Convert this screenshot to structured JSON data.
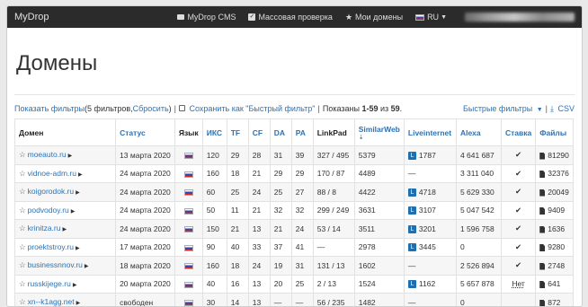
{
  "navbar": {
    "brand": "MyDrop",
    "cms": "MyDrop CMS",
    "bulk": "Массовая проверка",
    "my_domains": "Мои домены",
    "lang": "RU"
  },
  "page_title": "Домены",
  "toolbar": {
    "show_filters": "Показать фильтры",
    "filters_count": " (5 фильтров, ",
    "reset": "Сбросить",
    "close_paren": ")",
    "save_filter": "Сохранить как \"Быстрый фильтр\"",
    "shown_prefix": "Показаны ",
    "shown_range": "1-59",
    "shown_of": " из ",
    "shown_total": "59",
    "shown_dot": ".",
    "quick_filters": "Быстрые фильтры",
    "csv": "CSV"
  },
  "columns": [
    "Домен",
    "Статус",
    "Язык",
    "ИКС",
    "TF",
    "CF",
    "DA",
    "PA",
    "LinkPad",
    "SimilarWeb",
    "Liveinternet",
    "Alexa",
    "Ставка",
    "Файлы"
  ],
  "rows": [
    {
      "domain": "moeauto.ru",
      "status": "13 марта 2020",
      "iks": "120",
      "tf": "29",
      "cf": "28",
      "da": "31",
      "pa": "39",
      "linkpad": "327 / 495",
      "sw": "5379",
      "li": "1787",
      "alexa": "4 641 687",
      "bid": "✔",
      "files": "81290"
    },
    {
      "domain": "vidnoe-adm.ru",
      "status": "24 марта 2020",
      "iks": "160",
      "tf": "18",
      "cf": "21",
      "da": "29",
      "pa": "29",
      "linkpad": "170 / 87",
      "sw": "4489",
      "li": "—",
      "alexa": "3 311 040",
      "bid": "✔",
      "files": "32376"
    },
    {
      "domain": "koigorodok.ru",
      "status": "24 марта 2020",
      "iks": "60",
      "tf": "25",
      "cf": "24",
      "da": "25",
      "pa": "27",
      "linkpad": "88 / 8",
      "sw": "4422",
      "li": "4718",
      "alexa": "5 629 330",
      "bid": "✔",
      "files": "20049"
    },
    {
      "domain": "podvodoy.ru",
      "status": "24 марта 2020",
      "iks": "50",
      "tf": "11",
      "cf": "21",
      "da": "32",
      "pa": "32",
      "linkpad": "299 / 249",
      "sw": "3631",
      "li": "3107",
      "alexa": "5 047 542",
      "bid": "✔",
      "files": "9409"
    },
    {
      "domain": "krinitza.ru",
      "status": "24 марта 2020",
      "iks": "150",
      "tf": "21",
      "cf": "13",
      "da": "21",
      "pa": "24",
      "linkpad": "53 / 14",
      "sw": "3511",
      "li": "3201",
      "alexa": "1 596 758",
      "bid": "✔",
      "files": "1636"
    },
    {
      "domain": "proektstroy.ru",
      "status": "17 марта 2020",
      "iks": "90",
      "tf": "40",
      "cf": "33",
      "da": "37",
      "pa": "41",
      "linkpad": "—",
      "sw": "2978",
      "li": "3445",
      "alexa": "0",
      "bid": "✔",
      "files": "9280"
    },
    {
      "domain": "businessnnov.ru",
      "status": "18 марта 2020",
      "iks": "160",
      "tf": "18",
      "cf": "24",
      "da": "19",
      "pa": "31",
      "linkpad": "131 / 13",
      "sw": "1602",
      "li": "—",
      "alexa": "2 526 894",
      "bid": "✔",
      "files": "2748"
    },
    {
      "domain": "russkijege.ru",
      "status": "20 марта 2020",
      "iks": "40",
      "tf": "16",
      "cf": "13",
      "da": "20",
      "pa": "25",
      "linkpad": "2 / 13",
      "sw": "1524",
      "li": "1162",
      "alexa": "5 657 878",
      "bid": "Нет",
      "files": "641"
    },
    {
      "domain": "xn--k1agg.net",
      "status": "свободен",
      "iks": "30",
      "tf": "14",
      "cf": "13",
      "da": "—",
      "pa": "—",
      "linkpad": "56 / 235",
      "sw": "1482",
      "li": "—",
      "alexa": "0",
      "bid": "",
      "files": "872"
    }
  ]
}
